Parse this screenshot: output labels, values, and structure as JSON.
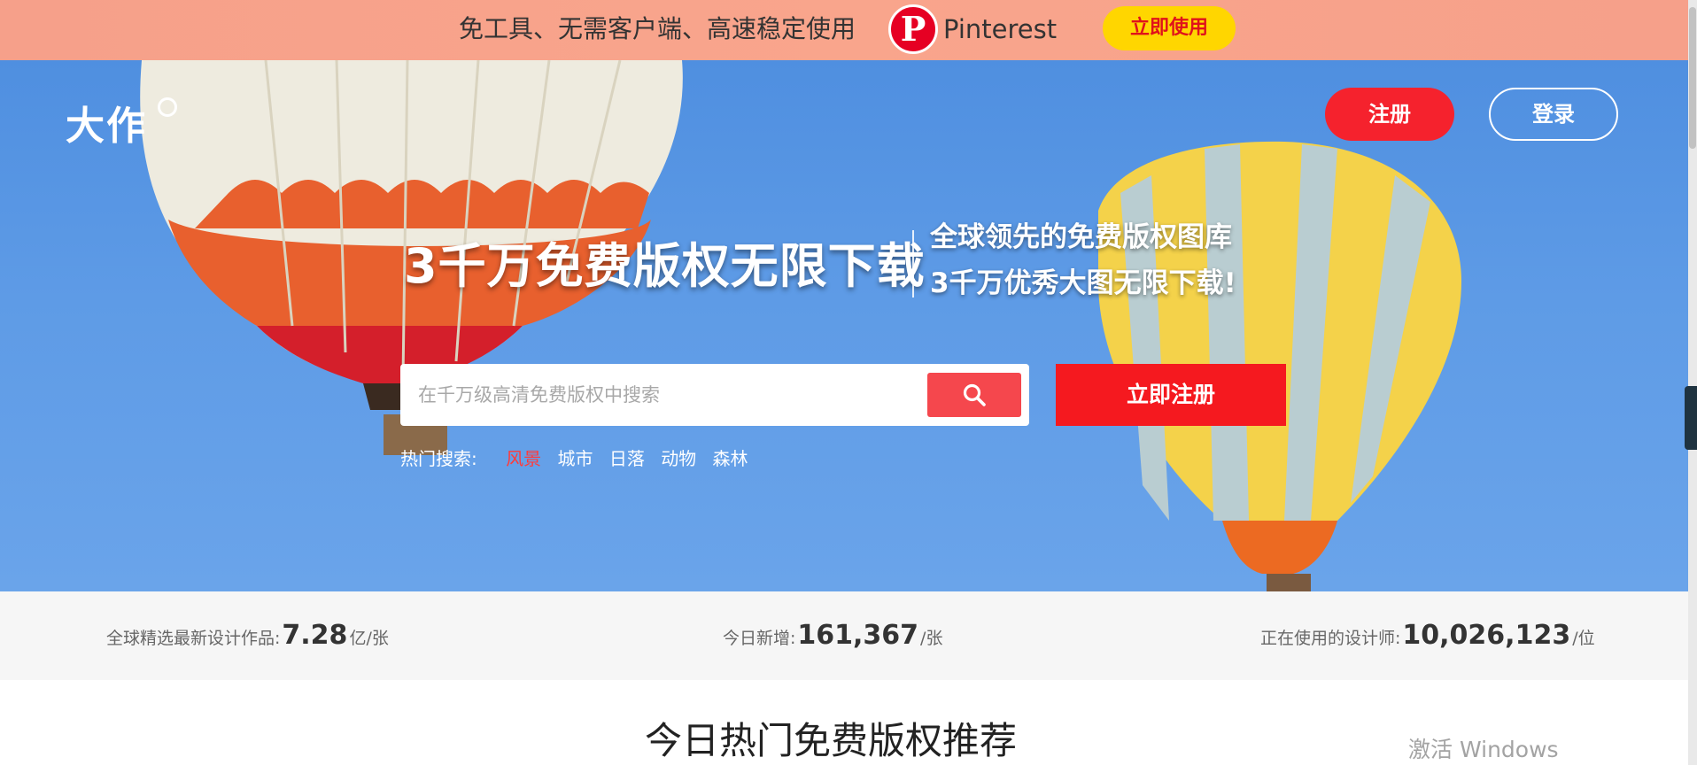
{
  "promo": {
    "text": "免工具、无需客户端、高速稳定使用",
    "brand_logo": "P",
    "brand_name": "Pinterest",
    "button": "立即使用"
  },
  "header": {
    "logo": "大作",
    "register": "注册",
    "login": "登录"
  },
  "hero": {
    "headline": "3千万免费版权无限下载",
    "subline_1": "全球领先的免费版权图库",
    "subline_2": "3千万优秀大图无限下载!",
    "search_placeholder": "在千万级高清免费版权中搜索",
    "cta": "立即注册",
    "hot_label": "热门搜索:",
    "hot_items": [
      "风景",
      "城市",
      "日落",
      "动物",
      "森林"
    ]
  },
  "stats": [
    {
      "label": "全球精选最新设计作品:",
      "value": "7.28",
      "unit": "亿/张"
    },
    {
      "label": "今日新增:",
      "value": "161,367",
      "unit": "/张"
    },
    {
      "label": "正在使用的设计师:",
      "value": "10,026,123",
      "unit": "/位"
    }
  ],
  "section": {
    "title": "今日热门免费版权推荐"
  },
  "watermark": "激活 Windows",
  "colors": {
    "promo_bg": "#f9a58c",
    "brand_red": "#f5222d",
    "sky": "#5e9be6",
    "promo_button": "#ffd600"
  }
}
